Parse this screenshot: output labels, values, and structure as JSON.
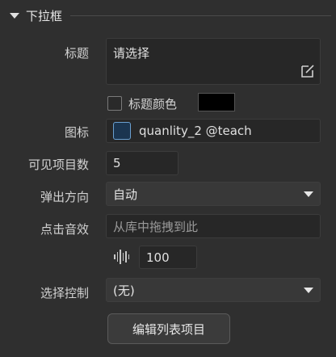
{
  "section": {
    "title": "下拉框",
    "collapse_icon": "triangle-down-icon"
  },
  "title_field": {
    "label": "标题",
    "value": "请选择",
    "edit_icon": "edit-icon"
  },
  "title_color": {
    "checkbox_label": "标题颜色",
    "checked": false,
    "color": "#000000"
  },
  "icon_field": {
    "label": "图标",
    "value": "quanlity_2 @teach",
    "asset_icon": "image-asset-icon"
  },
  "visible_count": {
    "label": "可见项目数",
    "value": "5"
  },
  "direction": {
    "label": "弹出方向",
    "value": "自动",
    "caret_icon": "chevron-down-icon"
  },
  "click_sound": {
    "label": "点击音效",
    "placeholder": "从库中拖拽到此",
    "volume_icon": "audio-wave-icon",
    "volume": "100"
  },
  "selection_control": {
    "label": "选择控制",
    "value": "(无)",
    "caret_icon": "chevron-down-icon"
  },
  "edit_list_button": {
    "label": "编辑列表项目"
  },
  "colors": {
    "background": "#2f2f2f",
    "field": "#272727",
    "dropdown": "#383838",
    "text": "#d4d4d4",
    "accent": "#6aa0d0"
  }
}
